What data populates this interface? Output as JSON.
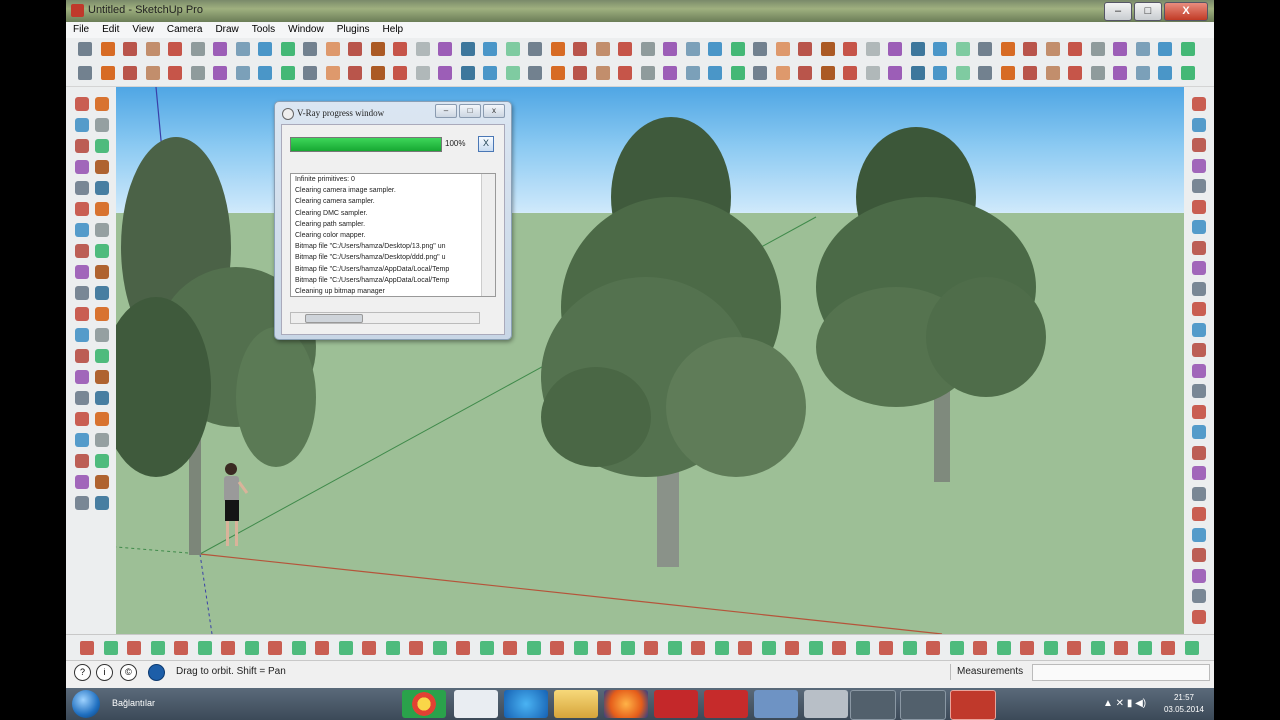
{
  "window": {
    "title": "Untitled - SketchUp Pro",
    "minimize_label": "–",
    "maximize_label": "□",
    "close_label": "X"
  },
  "menu": [
    "File",
    "Edit",
    "View",
    "Camera",
    "Draw",
    "Tools",
    "Window",
    "Plugins",
    "Help"
  ],
  "vray": {
    "title": "V-Ray progress window",
    "progress_percent": 100,
    "progress_label": "100%",
    "cancel_label": "X",
    "log": [
      "Infinite primitives: 0",
      "Clearing camera image sampler.",
      "Clearing camera sampler.",
      "Clearing DMC sampler.",
      "Clearing path sampler.",
      "Clearing color mapper.",
      "Bitmap file \"C:/Users/hamza/Desktop/13.png\" un",
      "Bitmap file \"C:/Users/hamza/Desktop/ddd.png\" u",
      "Bitmap file \"C:/Users/hamza/AppData/Local/Temp",
      "Bitmap file \"C:/Users/hamza/AppData/Local/Temp",
      "Cleaning up bitmap manager"
    ]
  },
  "status": {
    "hint": "Drag to orbit.  Shift = Pan",
    "measurements_label": "Measurements"
  },
  "taskbar": {
    "label": "Bağlantılar",
    "time": "21:57",
    "date": "03.05.2014"
  },
  "colors": {
    "sky_top": "#4fa6e4",
    "ground": "#9dbf96",
    "progress": "#16a832",
    "red_axis": "#b5543a",
    "green_axis": "#3f8a4a",
    "blue_axis": "#3a3fa8"
  },
  "icons": {
    "orbit": "orbit-icon",
    "select": "select-icon",
    "paint": "paint-bucket-icon"
  }
}
